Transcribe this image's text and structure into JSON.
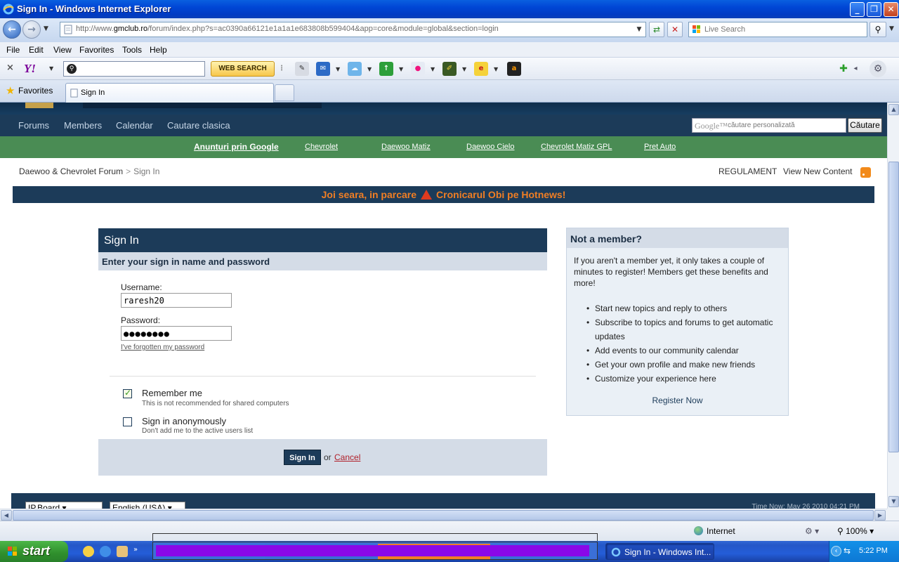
{
  "window": {
    "title": "Sign In - Windows Internet Explorer"
  },
  "addressbar": {
    "url_prefix": "http://www.",
    "url_domain": "gmclub.ro",
    "url_path": "/forum/index.php?s=ac0390a66121e1a1a1e683808b599404&app=core&module=global&section=login",
    "live_search_placeholder": "Live Search"
  },
  "menubar": {
    "items": [
      "File",
      "Edit",
      "View",
      "Favorites",
      "Tools",
      "Help"
    ]
  },
  "yahoo_toolbar": {
    "close": "×",
    "logo": "Y!",
    "search_value": "",
    "web_search_label": "WEB SEARCH"
  },
  "tabs": {
    "favorites_label": "Favorites",
    "active_tab_label": "Sign In"
  },
  "site_nav": {
    "items": [
      "Forums",
      "Members",
      "Calendar",
      "Cautare clasica"
    ],
    "google_logo": "Google™",
    "google_placeholder": "căutare personalizată",
    "google_button": "Căutare"
  },
  "ad_strip": {
    "header": "Anunturi prin Google",
    "links": [
      "Chevrolet",
      "Daewoo Matiz",
      "Daewoo Cielo",
      "Chevrolet Matiz GPL",
      "Pret Auto"
    ]
  },
  "breadcrumb": {
    "home": "Daewoo & Chevrolet Forum",
    "separator": ">",
    "current": "Sign In"
  },
  "top_links": {
    "rules": "REGULAMENT",
    "new_content": "View New Content"
  },
  "announcement": {
    "text_before": "Joi seara, in parcare",
    "text_after": "Cronicarul Obi pe Hotnews!"
  },
  "signin": {
    "title": "Sign In",
    "subtitle": "Enter your sign in name and password",
    "username_label": "Username:",
    "username_value": "raresh20",
    "password_label": "Password:",
    "password_value": "●●●●●●●●",
    "forgot_link": "I've forgotten my password",
    "remember_label": "Remember me",
    "remember_desc": "This is not recommended for shared computers",
    "remember_checked": true,
    "anon_label": "Sign in anonymously",
    "anon_desc": "Don't add me to the active users list",
    "anon_checked": false,
    "submit_label": "Sign In",
    "or_text": "or",
    "cancel_label": "Cancel"
  },
  "member_box": {
    "title": "Not a member?",
    "intro": "If you aren't a member yet, it only takes a couple of minutes to register! Members get these benefits and more!",
    "benefits": [
      "Start new topics and reply to others",
      "Subscribe to topics and forums to get automatic updates",
      "Add events to our community calendar",
      "Get your own profile and make new friends",
      "Customize your experience here"
    ],
    "register_link": "Register Now"
  },
  "footer": {
    "skin_select": "IP.Board",
    "lang_select": "English (USA)",
    "time": "Time Now: May 26 2010 04:21 PM"
  },
  "statusbar": {
    "zone": "Internet",
    "zoom": "100%"
  },
  "taskbar": {
    "start_label": "start",
    "active_item": "Sign In - Windows Int...",
    "clock": "5:22 PM"
  },
  "colors": {
    "site_dark": "#1c3b59",
    "ad_green": "#4a8c54",
    "announce_orange": "#f07e24",
    "redaction_purple": "#8a08e8"
  }
}
